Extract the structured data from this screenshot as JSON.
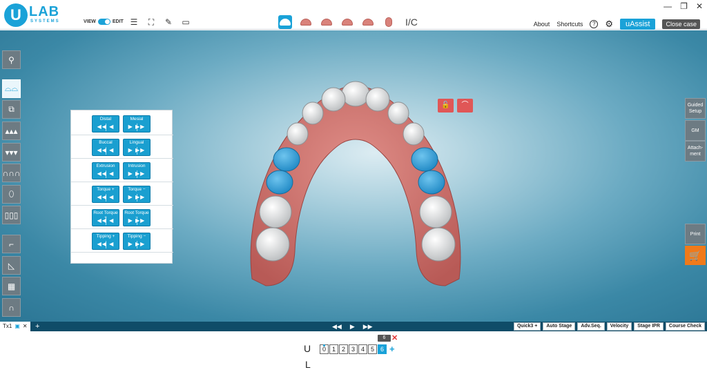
{
  "brand": {
    "logo_letter": "U",
    "logo_name": "LAB",
    "logo_sub": "SYSTEMS"
  },
  "mode": {
    "view_label": "VIEW",
    "edit_label": "EDIT"
  },
  "header": {
    "ic_label": "I/C",
    "about": "About",
    "shortcuts": "Shortcuts",
    "help_icon": "?",
    "uassist": "uAssist",
    "close_case": "Close case"
  },
  "window": {
    "minimize": "—",
    "maximize": "❐",
    "close": "✕"
  },
  "tooth_panel": {
    "rows": [
      {
        "left": "Distal",
        "right": "Mesial"
      },
      {
        "left": "Buccal",
        "right": "Lingual"
      },
      {
        "left": "Extrusion",
        "right": "Intrusion"
      },
      {
        "left": "Torque +",
        "right": "Torque −"
      },
      {
        "left": "Root Torque +",
        "right": "Root Torque −"
      },
      {
        "left": "Tipping +",
        "right": "Tipping −"
      }
    ]
  },
  "right_toolbar": {
    "guided_setup": "Guided Setup",
    "gm": "GM",
    "attachment": "Attach-ment",
    "print": "Print"
  },
  "timeline": {
    "tab_label": "Tx1",
    "buttons": [
      "Quick3 +",
      "Auto Stage",
      "Adv.Seq.",
      "Velocity",
      "Stage IPR",
      "Course Check"
    ]
  },
  "stages": {
    "upper_label": "U",
    "lower_label": "L",
    "upper": [
      "0",
      "1",
      "2",
      "3",
      "4",
      "5",
      "6"
    ],
    "current_index": 6,
    "current_bubble": "6"
  },
  "colors": {
    "accent": "#1aa2d8",
    "selected_tooth": "#2b9fd6",
    "gum": "#c96b67",
    "cart": "#f07a1a",
    "lock": "#e05757"
  }
}
